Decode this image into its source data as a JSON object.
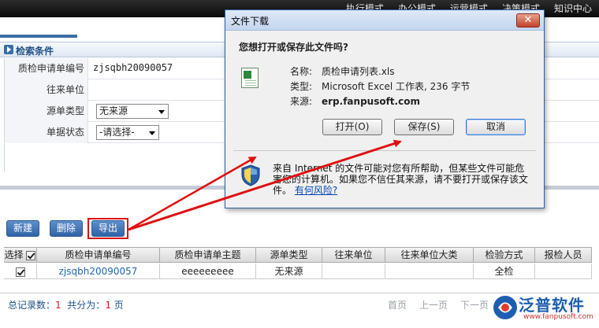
{
  "topnav": [
    "执行模式",
    "办公模式",
    "运营模式",
    "决策模式",
    "知识中心"
  ],
  "search_panel": {
    "title": "检索条件",
    "fields": [
      {
        "label": "质检申请单编号",
        "value": "zjsqbh20090057"
      },
      {
        "label": "往来单位",
        "value": ""
      },
      {
        "label": "源单类型",
        "value": "无来源"
      },
      {
        "label": "单据状态",
        "value": "-请选择-"
      }
    ]
  },
  "toolbar": {
    "new_label": "新建",
    "delete_label": "删除",
    "export_label": "导出"
  },
  "grid": {
    "columns": [
      "选择",
      "质检申请单编号",
      "质检申请单主题",
      "源单类型",
      "往来单位",
      "往来单位大类",
      "检验方式",
      "报检人员"
    ],
    "rows": [
      [
        "",
        "zjsqbh20090057",
        "eeeeeeeee",
        "无来源",
        "",
        "",
        "全检",
        ""
      ]
    ]
  },
  "footer": {
    "total_label": "总记录数：",
    "total": "1",
    "pages_label": "共分为：",
    "pages": "1",
    "pages_unit": "页",
    "pager": [
      "首页",
      "上一页",
      "下一页"
    ]
  },
  "logo": {
    "text": "泛普软件",
    "url": "www.fanpusoft.com"
  },
  "dialog": {
    "title": "文件下载",
    "question": "您想打开或保存此文件吗?",
    "name_label": "名称:",
    "name": "质检申请列表.xls",
    "type_label": "类型:",
    "type": "Microsoft Excel 工作表, 236 字节",
    "source_label": "来源:",
    "source": "erp.fanpusoft.com",
    "open_label": "打开(O)",
    "save_label": "保存(S)",
    "cancel_label": "取消",
    "warning": "来自 Internet 的文件可能对您有所帮助，但某些文件可能危害您的计算机。如果您不信任其来源，请不要打开或保存该文件。",
    "risk_link": "有何风险?"
  },
  "colors": {
    "accent": "#2f63a6",
    "highlight": "#e01010"
  }
}
